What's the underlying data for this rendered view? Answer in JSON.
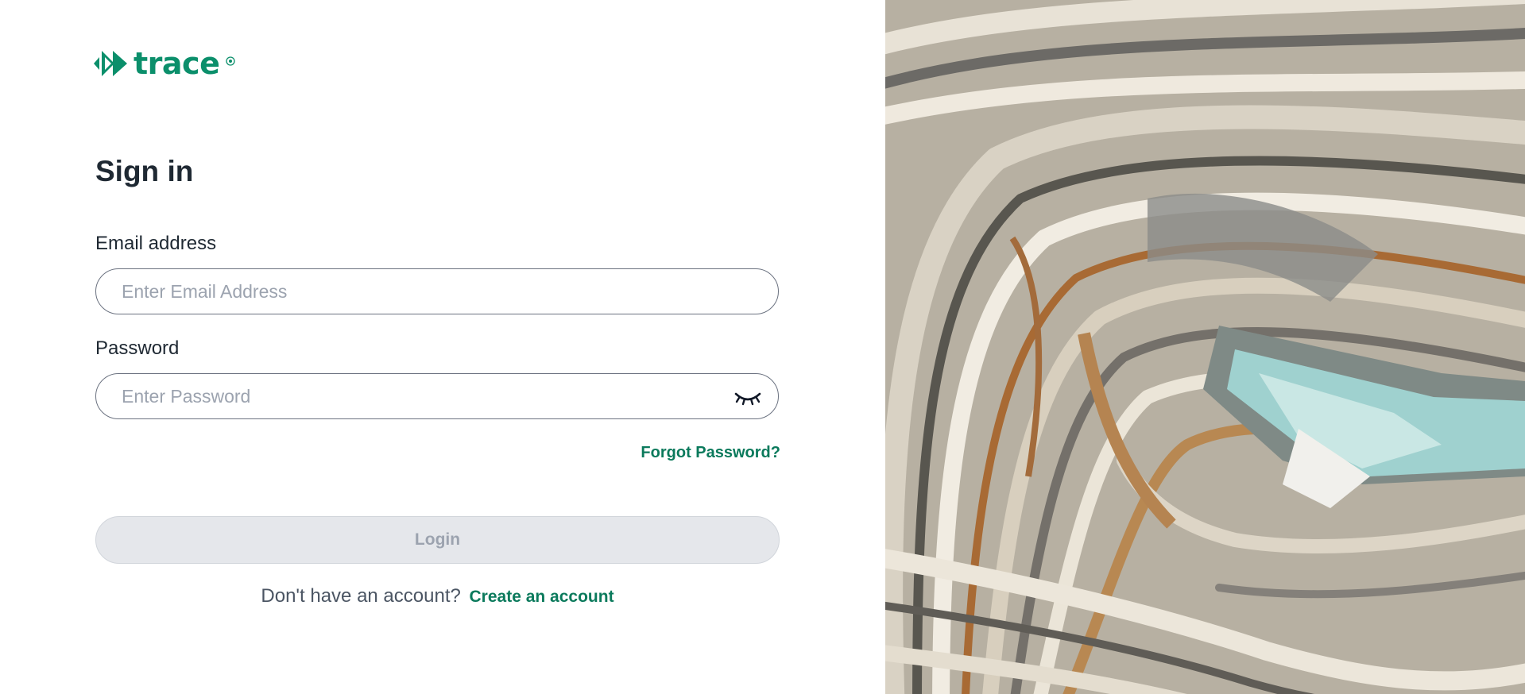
{
  "brand": {
    "name": "trace",
    "color": "#0b8f6b",
    "icon": "fast-forward-logo-icon",
    "registered_icon": "registered-mark-icon"
  },
  "signin": {
    "title": "Sign in",
    "email": {
      "label": "Email address",
      "placeholder": "Enter Email Address",
      "value": ""
    },
    "password": {
      "label": "Password",
      "placeholder": "Enter Password",
      "value": "",
      "toggle_icon": "eye-closed-icon"
    },
    "forgot_link": "Forgot Password?",
    "login_button": "Login",
    "no_account_text": "Don't have an account?",
    "create_account_link": "Create an account"
  },
  "colors": {
    "accent": "#0b7a5c",
    "button_disabled_bg": "#e5e7eb",
    "button_disabled_text": "#9ca3af",
    "text_primary": "#1f2933"
  },
  "hero_image": {
    "subject": "aerial-open-pit-mine-image"
  }
}
